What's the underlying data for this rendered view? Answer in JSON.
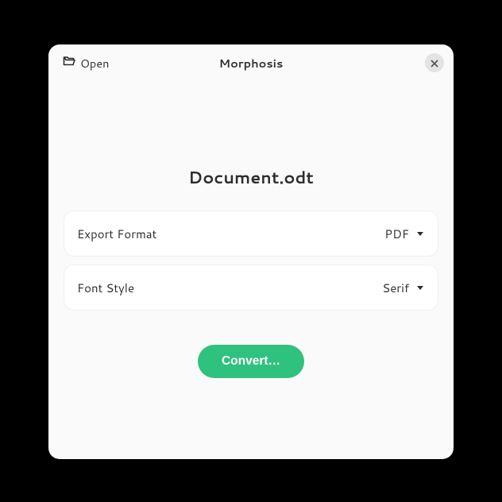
{
  "titlebar": {
    "open_label": "Open",
    "app_title": "Morphosis"
  },
  "document": {
    "filename": "Document.odt"
  },
  "rows": {
    "export_format": {
      "label": "Export Format",
      "value": "PDF"
    },
    "font_style": {
      "label": "Font Style",
      "value": "Serif"
    }
  },
  "actions": {
    "convert_label": "Convert…"
  },
  "colors": {
    "accent": "#2ec27e"
  }
}
